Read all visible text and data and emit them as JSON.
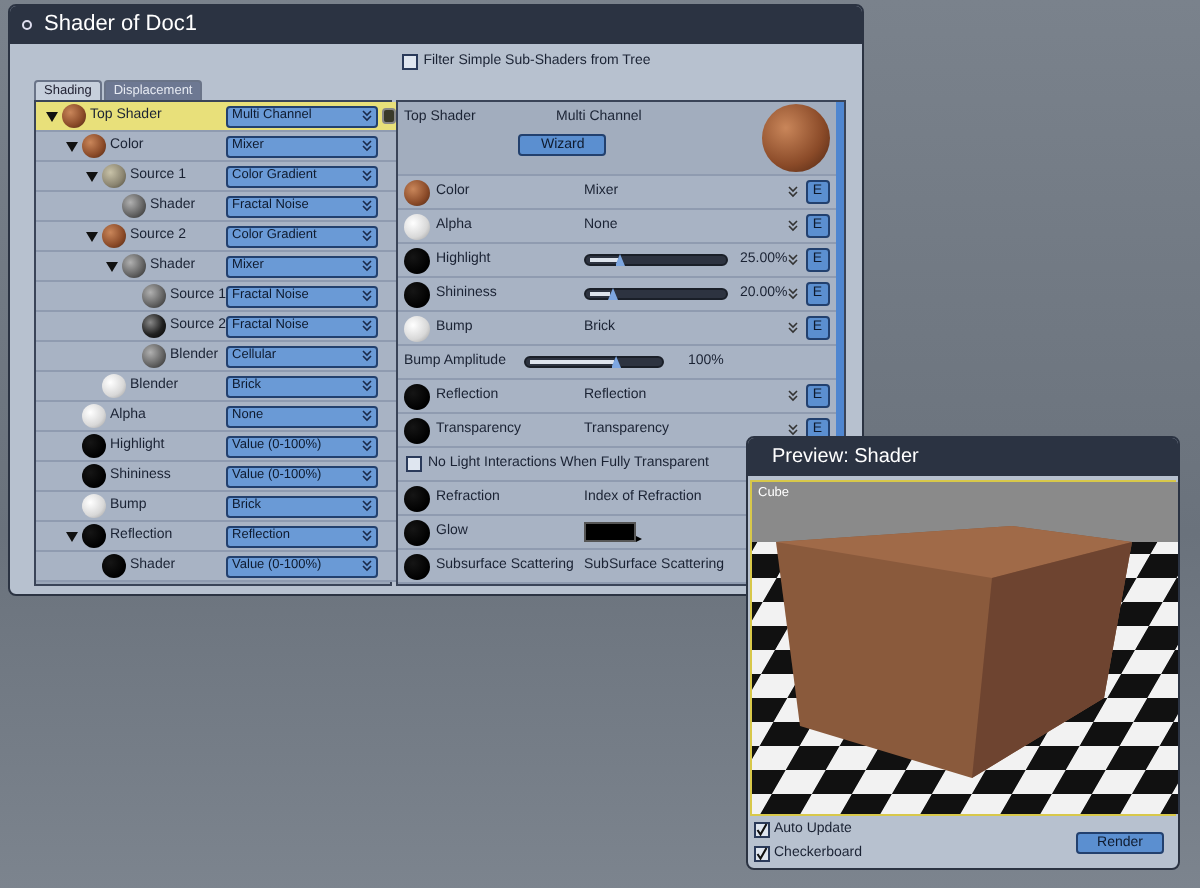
{
  "window": {
    "title": "Shader of Doc1"
  },
  "filter": {
    "label": "Filter Simple Sub-Shaders from Tree",
    "checked": false
  },
  "tabs": [
    {
      "label": "Shading",
      "selected": true
    },
    {
      "label": "Displacement",
      "selected": false
    }
  ],
  "tree": [
    {
      "label": "Top Shader",
      "value": "Multi Channel",
      "kind": "rust",
      "selected": true,
      "expanded": true,
      "children": [
        {
          "label": "Color",
          "value": "Mixer",
          "kind": "rust",
          "selected": false,
          "expanded": true,
          "children": [
            {
              "label": "Source 1",
              "value": "Color Gradient",
              "kind": "stone",
              "selected": false,
              "expanded": true,
              "children": [
                {
                  "label": "Shader",
                  "value": "Fractal Noise",
                  "kind": "noise",
                  "selected": false
                }
              ]
            },
            {
              "label": "Source 2",
              "value": "Color Gradient",
              "kind": "rust",
              "selected": false,
              "expanded": true,
              "children": [
                {
                  "label": "Shader",
                  "value": "Mixer",
                  "kind": "noise",
                  "selected": false,
                  "expanded": true,
                  "children": [
                    {
                      "label": "Source 1",
                      "value": "Fractal Noise",
                      "kind": "noise",
                      "selected": false
                    },
                    {
                      "label": "Source 2",
                      "value": "Fractal Noise",
                      "kind": "spots",
                      "selected": false
                    },
                    {
                      "label": "Blender",
                      "value": "Cellular",
                      "kind": "noise",
                      "selected": false
                    }
                  ]
                }
              ]
            },
            {
              "label": "Blender",
              "value": "Brick",
              "kind": "white",
              "selected": false
            }
          ]
        },
        {
          "label": "Alpha",
          "value": "None",
          "kind": "white",
          "selected": false
        },
        {
          "label": "Highlight",
          "value": "Value (0-100%)",
          "kind": "black",
          "selected": false
        },
        {
          "label": "Shininess",
          "value": "Value (0-100%)",
          "kind": "black",
          "selected": false
        },
        {
          "label": "Bump",
          "value": "Brick",
          "kind": "white",
          "selected": false
        },
        {
          "label": "Reflection",
          "value": "Reflection",
          "kind": "black",
          "selected": false,
          "expanded": true,
          "children": [
            {
              "label": "Shader",
              "value": "Value (0-100%)",
              "kind": "black",
              "selected": false
            }
          ]
        }
      ]
    }
  ],
  "detail": {
    "title": "Top Shader",
    "value": "Multi Channel",
    "wizard": "Wizard",
    "rows": [
      {
        "kind": "channel",
        "label": "Color",
        "material": {
          "kind": "rust"
        },
        "value": "Mixer",
        "button": "E"
      },
      {
        "kind": "channel",
        "label": "Alpha",
        "material": {
          "kind": "white"
        },
        "value": "None",
        "button": "E"
      },
      {
        "kind": "slider",
        "label": "Highlight",
        "material": {
          "kind": "black"
        },
        "level": 0.25,
        "reading": "25.00%",
        "button": "E"
      },
      {
        "kind": "slider",
        "label": "Shininess",
        "material": {
          "kind": "black"
        },
        "level": 0.2,
        "reading": "20.00%",
        "button": "E"
      },
      {
        "kind": "channel",
        "label": "Bump",
        "material": {
          "kind": "white"
        },
        "value": "Brick",
        "button": "E"
      },
      {
        "kind": "amplitude",
        "label": "Bump Amplitude",
        "level": 0.67,
        "reading": "100%"
      },
      {
        "kind": "channel",
        "label": "Reflection",
        "material": {
          "kind": "black"
        },
        "value": "Reflection",
        "button": "E"
      },
      {
        "kind": "channel",
        "label": "Transparency",
        "material": {
          "kind": "black"
        },
        "value": "Transparency",
        "button": "E"
      },
      {
        "kind": "checkbox",
        "label": "No Light Interactions When Fully Transparent",
        "checked": false
      },
      {
        "kind": "channel",
        "label": "Refraction",
        "material": {
          "kind": "black"
        },
        "value": "Index of Refraction"
      },
      {
        "kind": "color",
        "label": "Glow",
        "material": {
          "kind": "black"
        },
        "color": "#000000"
      },
      {
        "kind": "channel",
        "label": "Subsurface Scattering",
        "material": {
          "kind": "black"
        },
        "value": "SubSurface Scattering"
      }
    ]
  },
  "preview": {
    "title": "Preview: Shader",
    "object": "Cube",
    "options": [
      {
        "label": "Auto Update",
        "checked": true
      },
      {
        "label": "Checkerboard",
        "checked": true
      }
    ],
    "render": "Render"
  }
}
